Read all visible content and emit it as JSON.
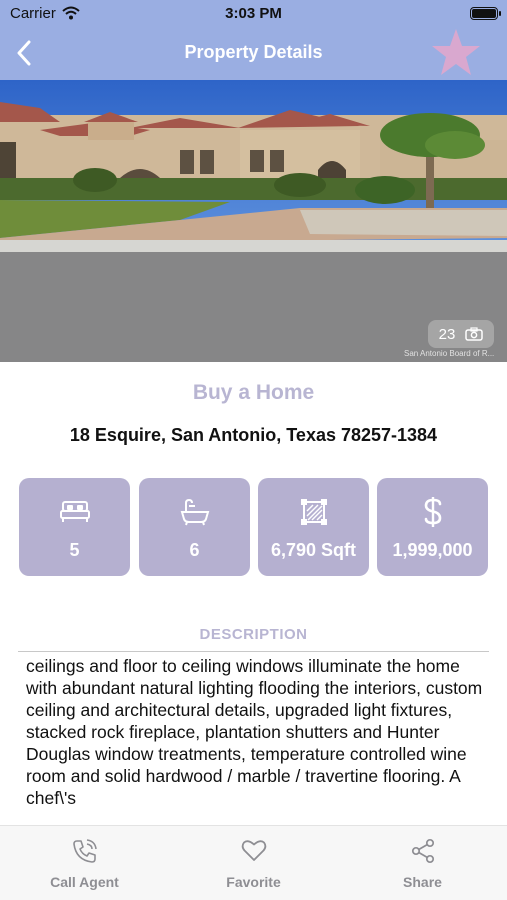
{
  "status_bar": {
    "carrier": "Carrier",
    "time": "3:03 PM"
  },
  "nav": {
    "title": "Property Details",
    "back_icon": "chevron-left-icon",
    "favorite_icon": "star-icon"
  },
  "colors": {
    "header": "#9aaee2",
    "accent": "#b5b0d0",
    "muted_text": "#b8b5d2",
    "tab_text": "#8e8e93"
  },
  "hero": {
    "photo_count": "23",
    "camera_icon": "camera-icon",
    "watermark": "San Antonio Board of R..."
  },
  "listing": {
    "category": "Buy a Home",
    "address": "18 Esquire, San Antonio, Texas 78257-1384"
  },
  "stats": [
    {
      "icon": "bed-icon",
      "value": "5"
    },
    {
      "icon": "bathtub-icon",
      "value": "6"
    },
    {
      "icon": "area-icon",
      "value": "6,790 Sqft"
    },
    {
      "icon": "dollar-icon",
      "value": "1,999,000"
    }
  ],
  "description": {
    "heading": "DESCRIPTION",
    "text": "ceilings and floor to ceiling windows illuminate the home with abundant natural lighting flooding the interiors, custom ceiling and architectural details, upgraded light fixtures, stacked rock fireplace, plantation shutters and Hunter Douglas window treatments, temperature controlled wine room and solid hardwood / marble / travertine flooring. A chef\\'s"
  },
  "tabs": [
    {
      "label": "Call Agent",
      "icon": "phone-icon"
    },
    {
      "label": "Favorite",
      "icon": "heart-icon"
    },
    {
      "label": "Share",
      "icon": "share-icon"
    }
  ]
}
